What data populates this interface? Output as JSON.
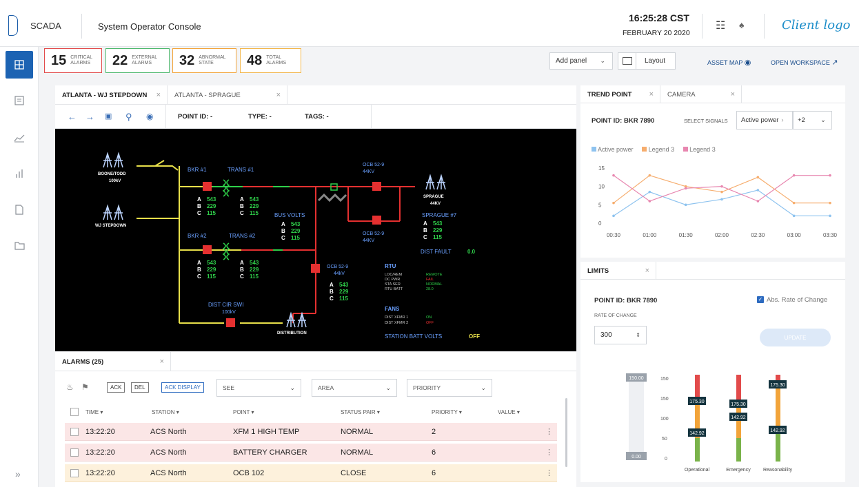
{
  "header": {
    "brand": "SCADA",
    "title": "System Operator Console",
    "time": "16:25:28 CST",
    "date": "FEBRUARY 20 2020",
    "client_logo": "Client logo"
  },
  "sidebar": {
    "items": [
      {
        "icon": "grid-icon",
        "active": true
      },
      {
        "icon": "list-icon"
      },
      {
        "icon": "line-chart-icon"
      },
      {
        "icon": "bar-chart-icon"
      },
      {
        "icon": "document-icon"
      },
      {
        "icon": "folder-icon"
      }
    ],
    "expand": "»"
  },
  "counters": [
    {
      "value": "15",
      "label": "CRITICAL ALARMS"
    },
    {
      "value": "22",
      "label": "EXTERNAL ALARMS"
    },
    {
      "value": "32",
      "label": "ABNORMAL STATE"
    },
    {
      "value": "48",
      "label": "TOTAL ALARMS"
    }
  ],
  "toolbar": {
    "add_panel": "Add panel",
    "layout": "Layout",
    "asset_map": "ASSET MAP",
    "open_workspace": "OPEN WORKSPACE"
  },
  "diagram_tabs": [
    {
      "label": "ATLANTA - WJ STEPDOWN",
      "active": true
    },
    {
      "label": "ATLANTA - SPRAGUE",
      "active": false
    }
  ],
  "diagram_toolbar": {
    "point_id": "POINT ID: -",
    "type": "TYPE: -",
    "tags": "TAGS: -"
  },
  "diagram": {
    "boone_tood": "BOONE/TODD",
    "boone_kv": "100kV",
    "wj_stepdown": "WJ STEPDOWN",
    "bkr1": "BKR #1",
    "trans1": "TRANS #1",
    "bkr2": "BKR #2",
    "trans2": "TRANS #2",
    "a_val": "543",
    "b_val": "229",
    "c_val": "115",
    "bus_volts": "BUS VOLTS",
    "ocb_top": "OCB 52-9",
    "ocb_top_kv": "44KV",
    "ocb_mid": "OCB 52-9",
    "ocb_mid_kv": "44KV",
    "ocb_low": "OCB 52-9",
    "ocb_low_kv": "44kV",
    "sprague": "SPRAGUE",
    "sprague_kv": "44KV",
    "sprague7": "SPRAGUE #7",
    "dist_fault": "DIST FAULT",
    "dist_fault_val": "0.0",
    "rtu": "RTU",
    "rtu_rows": [
      {
        "k": "LOC/REM",
        "v": "REMOTE",
        "c": "#2fd04a"
      },
      {
        "k": "DC PWR",
        "v": "FAIL",
        "c": "#e53030"
      },
      {
        "k": "STA SER",
        "v": "NORMAL",
        "c": "#2fd04a"
      },
      {
        "k": "RTU BATT",
        "v": "28.0",
        "c": "#2fd04a"
      }
    ],
    "fans": "FANS",
    "fan_rows": [
      {
        "k": "DIST XFMR 1",
        "v": "ON",
        "c": "#2fd04a"
      },
      {
        "k": "DIST XFMR 2",
        "v": "OFF",
        "c": "#e53030"
      }
    ],
    "dist_cir": "DIST CIR SWI",
    "dist_cir_kv": "100kV",
    "distribution": "DISTRIBUTION",
    "station_batt": "STATION BATT VOLTS",
    "station_batt_val": "OFF"
  },
  "alarms": {
    "tab": "ALARMS (25)",
    "ack": "ACK",
    "del": "DEL",
    "ack_display": "ACK DISPLAY",
    "filters": [
      "SEE",
      "AREA",
      "PRIORITY"
    ],
    "columns": [
      "TIME",
      "STATION",
      "POINT",
      "STATUS PAIR",
      "PRIORITY",
      "VALUE"
    ],
    "rows": [
      {
        "time": "13:22:20",
        "station": "ACS North",
        "point": "XFM 1 HIGH TEMP",
        "status": "NORMAL",
        "priority": "2",
        "bg": "#fbe6e6"
      },
      {
        "time": "13:22:20",
        "station": "ACS North",
        "point": "BATTERY CHARGER",
        "status": "NORMAL",
        "priority": "6",
        "bg": "#fbe6e6"
      },
      {
        "time": "13:22:20",
        "station": "ACS North",
        "point": "OCB 102",
        "status": "CLOSE",
        "priority": "6",
        "bg": "#fdf1dc"
      }
    ]
  },
  "trend": {
    "tabs": [
      "TREND POINT",
      "CAMERA"
    ],
    "point_id": "POINT ID: BKR 7890",
    "select_signals": "SELECT SIGNALS",
    "signal_value": "Active power",
    "signal_more": "+2",
    "colors": {
      "blue": "#8ec3ef",
      "orange": "#f6ad6e",
      "pink": "#e887b0"
    }
  },
  "chart_data": {
    "type": "line",
    "categories": [
      "00:30",
      "01:00",
      "01:30",
      "02:00",
      "02:30",
      "03:00",
      "03:30"
    ],
    "series": [
      {
        "name": "Active power",
        "values": [
          2,
          8.5,
          5,
          6.5,
          9,
          2,
          2
        ]
      },
      {
        "name": "Legend 3",
        "values": [
          5.5,
          13,
          10,
          8.5,
          12.5,
          5.5,
          5.5
        ]
      },
      {
        "name": "Legend 3",
        "values": [
          13,
          6,
          9.5,
          10,
          6,
          13,
          13
        ]
      }
    ],
    "yticks": [
      0,
      5,
      10,
      15
    ],
    "ylim": [
      0,
      15
    ],
    "legend": "top-left"
  },
  "limits": {
    "tab": "LIMITS",
    "point_id": "POINT ID: BKR 7890",
    "abs_roc": "Abs. Rate of Change",
    "rate_label": "RATE OF CHANGE",
    "rate_value": "300",
    "update": "UPDATE",
    "slider_top": "150.00",
    "slider_bottom": "0.00",
    "ticks": [
      "150",
      "150",
      "100",
      "50",
      "0"
    ],
    "bars": [
      {
        "label": "Operational",
        "hi": "175.30",
        "lo": "142.92"
      },
      {
        "label": "Emergency",
        "hi": "175.30",
        "lo": "142.92"
      },
      {
        "label": "Reasonability",
        "hi": "175.30",
        "lo": "142.92"
      }
    ]
  }
}
